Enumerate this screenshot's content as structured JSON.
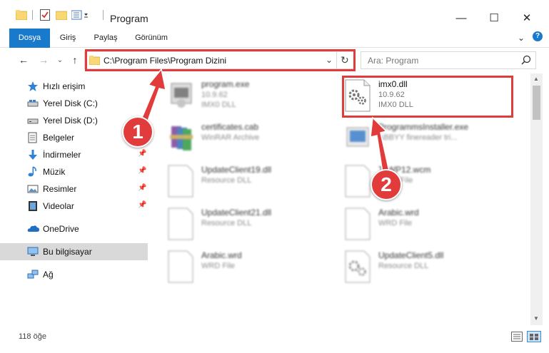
{
  "window": {
    "title": "Program",
    "minimize": "—",
    "maximize": "☐",
    "close": "✕"
  },
  "ribbon": {
    "tabs": [
      {
        "label": "Dosya",
        "active": true
      },
      {
        "label": "Giriş",
        "active": false
      },
      {
        "label": "Paylaş",
        "active": false
      },
      {
        "label": "Görünüm",
        "active": false
      }
    ]
  },
  "address": {
    "path": "C:\\Program Files\\Program Dizini"
  },
  "search": {
    "placeholder": "Ara: Program"
  },
  "nav": {
    "items": [
      {
        "label": "Hızlı erişim",
        "icon": "star-icon"
      },
      {
        "label": "Yerel Disk (C:)",
        "icon": "drive-icon"
      },
      {
        "label": "Yerel Disk (D:)",
        "icon": "drive-icon"
      },
      {
        "label": "Belgeler",
        "icon": "documents-icon"
      },
      {
        "label": "İndirmeler",
        "icon": "download-icon",
        "pinned": true
      },
      {
        "label": "Müzik",
        "icon": "music-icon",
        "pinned": true
      },
      {
        "label": "Resimler",
        "icon": "pictures-icon",
        "pinned": true
      },
      {
        "label": "Videolar",
        "icon": "video-icon",
        "pinned": true
      },
      {
        "label": "OneDrive",
        "icon": "cloud-icon"
      },
      {
        "label": "Bu bilgisayar",
        "icon": "computer-icon",
        "selected": true
      },
      {
        "label": "Ağ",
        "icon": "network-icon"
      }
    ]
  },
  "files": [
    {
      "name": "program.exe",
      "line1": "10.9.62",
      "line2": "IMX0 DLL",
      "icon": "exe-icon",
      "blurred": true
    },
    {
      "name": "imx0.dll",
      "line1": "10.9.62",
      "line2": "IMX0 DLL",
      "icon": "dll-gear-icon",
      "blurred": false
    },
    {
      "name": "certificates.cab",
      "line1": "WinRAR Archive",
      "line2": "",
      "icon": "winrar-icon",
      "blurred": true
    },
    {
      "name": "ProgrammsInstaller.exe",
      "line1": "ABBYY finereader tri...",
      "line2": "",
      "icon": "installer-icon",
      "blurred": true
    },
    {
      "name": "UpdateClient19.dll",
      "line1": "Resource DLL",
      "line2": "",
      "icon": "file-icon",
      "blurred": true
    },
    {
      "name": "ToWP12.wcm",
      "line1": "WCM File",
      "line2": "",
      "icon": "file-icon",
      "blurred": true
    },
    {
      "name": "UpdateClient21.dll",
      "line1": "Resource DLL",
      "line2": "",
      "icon": "file-icon",
      "blurred": true
    },
    {
      "name": "Arabic.wrd",
      "line1": "WRD File",
      "line2": "",
      "icon": "file-icon",
      "blurred": true
    },
    {
      "name": "Arabic.wrd",
      "line1": "WRD File",
      "line2": "",
      "icon": "file-icon",
      "blurred": true
    },
    {
      "name": "UpdateClient5.dll",
      "line1": "Resource DLL",
      "line2": "",
      "icon": "dll-gear-icon",
      "blurred": true
    }
  ],
  "status": {
    "count": "118 öğe"
  },
  "annotations": {
    "step1": "1",
    "step2": "2",
    "color": "#e03c3c"
  }
}
